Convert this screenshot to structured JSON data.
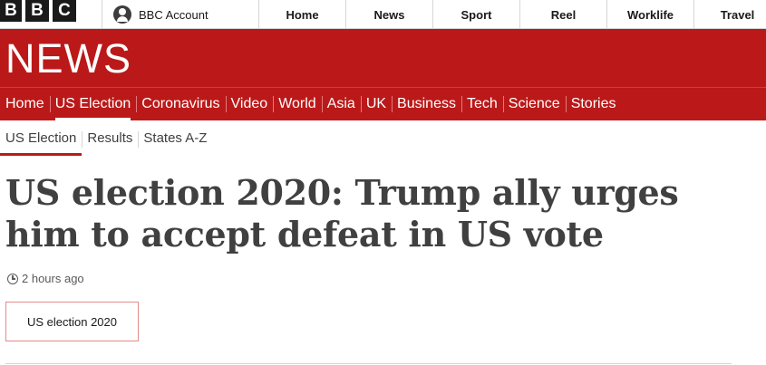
{
  "brand": {
    "letters": [
      "B",
      "B",
      "C"
    ]
  },
  "account": {
    "label": "BBC Account",
    "icon": "user-icon"
  },
  "top_nav": [
    "Home",
    "News",
    "Sport",
    "Reel",
    "Worklife",
    "Travel"
  ],
  "banner": {
    "wordmark": "NEWS",
    "color": "#bb1919"
  },
  "section_nav": {
    "items": [
      "Home",
      "US Election",
      "Coronavirus",
      "Video",
      "World",
      "Asia",
      "UK",
      "Business",
      "Tech",
      "Science",
      "Stories"
    ],
    "active": "US Election"
  },
  "sub_nav": {
    "items": [
      "US Election",
      "Results",
      "States A-Z"
    ],
    "active": "US Election"
  },
  "article": {
    "headline": "US election 2020: Trump ally urges him to accept defeat in US vote",
    "timestamp": "2 hours ago",
    "tag": "US election 2020"
  }
}
